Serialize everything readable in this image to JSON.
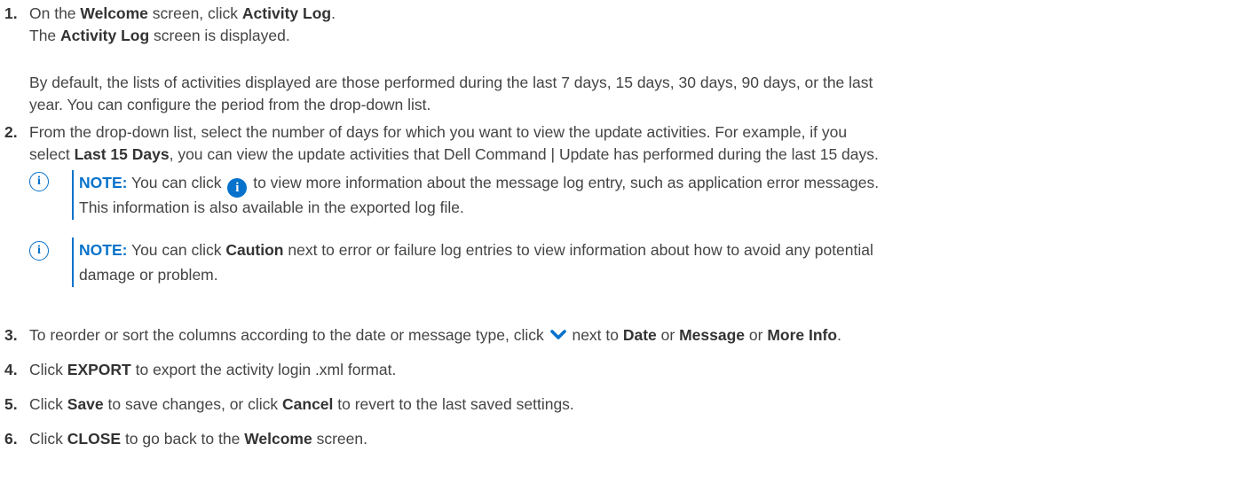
{
  "steps": [
    {
      "number": "1.",
      "line1": [
        "On the ",
        "Welcome",
        " screen, click ",
        "Activity Log",
        "."
      ],
      "line2": [
        "The ",
        "Activity Log",
        " screen is displayed."
      ],
      "para_line1": "By default, the lists of activities displayed are those performed during the last 7 days, 15 days, 30 days, 90 days, or the last",
      "para_line2": "year. You can configure the period from the drop-down list."
    },
    {
      "number": "2.",
      "line1": "From the drop-down list, select the number of days for which you want to view the update activities. For example, if you",
      "line2": [
        "select ",
        "Last 15 Days",
        ", you can view the update activities that Dell Command | Update has performed during the last 15 days."
      ],
      "notes": [
        {
          "label": "NOTE:",
          "line1_before": " You can click ",
          "icon": "info-circle-icon",
          "line1_after": " to view more information about the message log entry, such as application error messages.",
          "line2": "This information is also available in the exported log file."
        },
        {
          "label": "NOTE:",
          "line1": [
            " You can click ",
            "Caution",
            " next to error or failure log entries to view information about how to avoid any potential"
          ],
          "line2": "damage or problem."
        }
      ]
    },
    {
      "number": "3.",
      "before_icon": "To reorder or sort the columns according to the date or message type, click ",
      "icon": "chevron-down-icon",
      "after_icon": [
        " next to ",
        "Date",
        " or ",
        "Message",
        " or ",
        "More Info",
        "."
      ]
    },
    {
      "number": "4.",
      "text": [
        "Click ",
        "EXPORT",
        " to export the activity login .xml format."
      ]
    },
    {
      "number": "5.",
      "text": [
        "Click ",
        "Save",
        " to save changes, or click ",
        "Cancel",
        " to revert to the last saved settings."
      ]
    },
    {
      "number": "6.",
      "text": [
        "Click ",
        "CLOSE",
        " to go back to the ",
        "Welcome",
        " screen."
      ]
    }
  ],
  "colors": {
    "accent": "#0672cb",
    "text": "#444444",
    "heading": "#333333"
  }
}
